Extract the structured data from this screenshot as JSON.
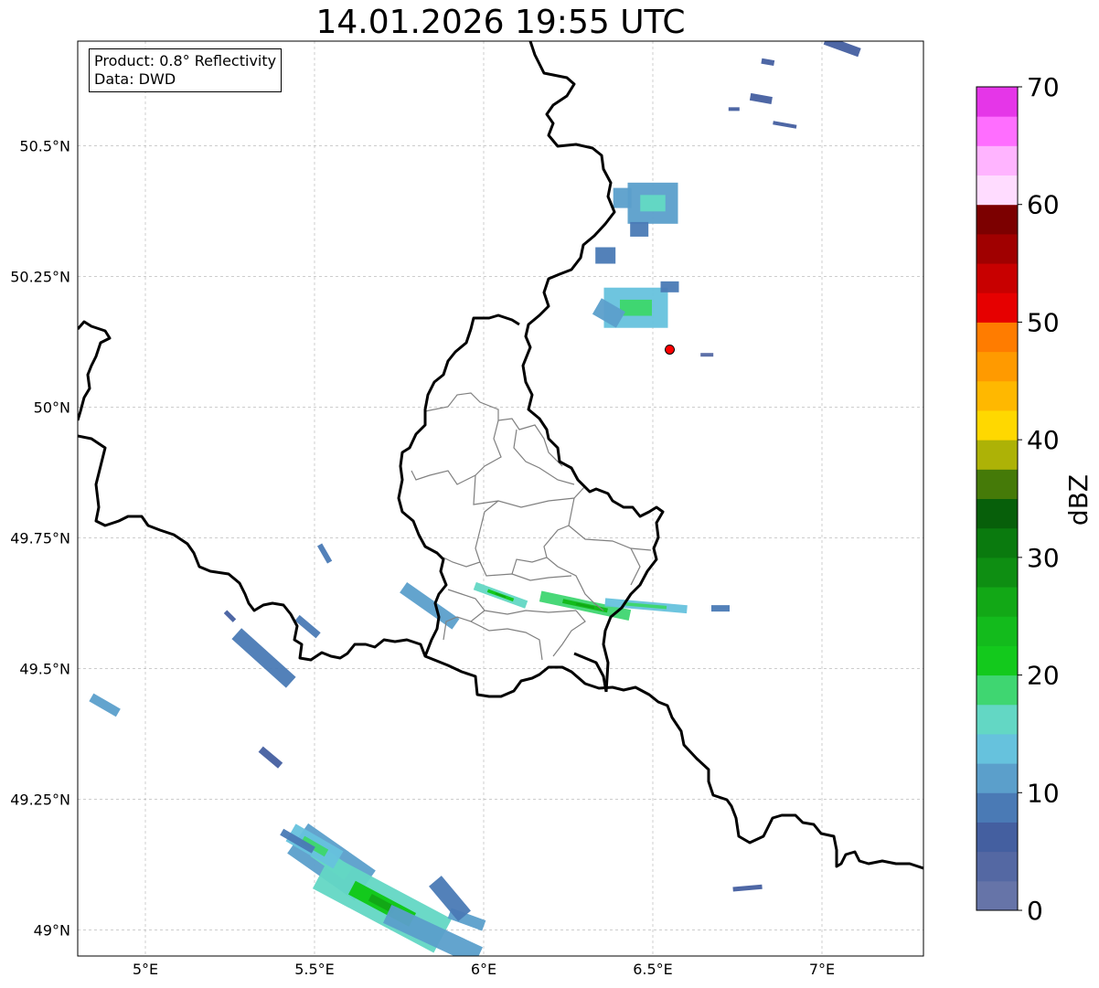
{
  "title": "14.01.2026 19:55 UTC",
  "info_box": {
    "product": "Product: 0.8° Reflectivity",
    "data": "Data: DWD"
  },
  "axes": {
    "lon_range": [
      4.8,
      7.3
    ],
    "lat_range": [
      48.95,
      50.7
    ],
    "lon_ticks": [
      {
        "value": 5.0,
        "label": "5°E"
      },
      {
        "value": 5.5,
        "label": "5.5°E"
      },
      {
        "value": 6.0,
        "label": "6°E"
      },
      {
        "value": 6.5,
        "label": "6.5°E"
      },
      {
        "value": 7.0,
        "label": "7°E"
      }
    ],
    "lat_ticks": [
      {
        "value": 49.0,
        "label": "49°N"
      },
      {
        "value": 49.25,
        "label": "49.25°N"
      },
      {
        "value": 49.5,
        "label": "49.5°N"
      },
      {
        "value": 49.75,
        "label": "49.75°N"
      },
      {
        "value": 50.0,
        "label": "50°N"
      },
      {
        "value": 50.25,
        "label": "50.25°N"
      },
      {
        "value": 50.5,
        "label": "50.5°N"
      }
    ],
    "grid": "dashed"
  },
  "colorbar": {
    "label": "dBZ",
    "min": 0,
    "max": 70,
    "step": 2.5,
    "tick_labels": [
      "0",
      "10",
      "20",
      "30",
      "40",
      "50",
      "60",
      "70"
    ],
    "colors": [
      "#6674a8",
      "#5468a3",
      "#445fa0",
      "#4a7ab5",
      "#5b9fcb",
      "#66c2dd",
      "#63d7c4",
      "#3fd671",
      "#13c91c",
      "#13bb1c",
      "#12a816",
      "#0e8e12",
      "#0a7a0e",
      "#075f0a",
      "#457a08",
      "#adb206",
      "#ffd800",
      "#ffb800",
      "#ff9a00",
      "#ff7c00",
      "#e60000",
      "#c80000",
      "#a00000",
      "#7c0000",
      "#ffdcff",
      "#ffb4ff",
      "#ff6eff",
      "#e536e8"
    ]
  },
  "marker": {
    "lon": 6.55,
    "lat": 50.11,
    "color": "#ff0000"
  },
  "echoes": [
    {
      "lon": 4.88,
      "lat": 49.43,
      "dbz": 10,
      "len": 34,
      "w": 10,
      "ang": 30
    },
    {
      "lon": 5.35,
      "lat": 49.52,
      "dbz": 8,
      "len": 80,
      "w": 16,
      "ang": 42
    },
    {
      "lon": 5.48,
      "lat": 49.58,
      "dbz": 8,
      "len": 30,
      "w": 8,
      "ang": 40
    },
    {
      "lon": 5.37,
      "lat": 49.33,
      "dbz": 6,
      "len": 28,
      "w": 8,
      "ang": 40
    },
    {
      "lon": 5.53,
      "lat": 49.72,
      "dbz": 8,
      "len": 22,
      "w": 6,
      "ang": 60
    },
    {
      "lon": 5.25,
      "lat": 49.6,
      "dbz": 6,
      "len": 14,
      "w": 5,
      "ang": 45
    },
    {
      "lon": 5.84,
      "lat": 49.62,
      "dbz": 10,
      "len": 70,
      "w": 14,
      "ang": 35
    },
    {
      "lon": 6.05,
      "lat": 49.64,
      "dbz": 16,
      "len": 60,
      "w": 9,
      "ang": 20
    },
    {
      "lon": 6.3,
      "lat": 49.62,
      "dbz": 18,
      "len": 100,
      "w": 12,
      "ang": 12
    },
    {
      "lon": 6.48,
      "lat": 49.62,
      "dbz": 14,
      "len": 90,
      "w": 9,
      "ang": 5
    },
    {
      "lon": 6.7,
      "lat": 49.615,
      "dbz": 8,
      "len": 20,
      "w": 7,
      "ang": 0
    },
    {
      "lon": 5.55,
      "lat": 49.13,
      "dbz": 12,
      "len": 90,
      "w": 40,
      "ang": 35
    },
    {
      "lon": 5.7,
      "lat": 49.05,
      "dbz": 16,
      "len": 150,
      "w": 42,
      "ang": 28
    },
    {
      "lon": 5.5,
      "lat": 49.16,
      "dbz": 14,
      "len": 60,
      "w": 22,
      "ang": 30
    },
    {
      "lon": 5.85,
      "lat": 48.99,
      "dbz": 10,
      "len": 110,
      "w": 22,
      "ang": 25
    },
    {
      "lon": 5.95,
      "lat": 49.02,
      "dbz": 10,
      "len": 40,
      "w": 12,
      "ang": 20
    },
    {
      "lon": 5.9,
      "lat": 49.06,
      "dbz": 8,
      "len": 50,
      "w": 18,
      "ang": 50
    },
    {
      "lon": 5.45,
      "lat": 49.17,
      "dbz": 8,
      "len": 40,
      "w": 8,
      "ang": 30
    },
    {
      "lon": 6.41,
      "lat": 50.4,
      "dbz": 10,
      "len": 20,
      "w": 22,
      "ang": 0
    },
    {
      "lon": 6.5,
      "lat": 50.39,
      "dbz": 12,
      "len": 55,
      "w": 45,
      "ang": 0
    },
    {
      "lon": 6.46,
      "lat": 50.34,
      "dbz": 8,
      "len": 20,
      "w": 16,
      "ang": 0
    },
    {
      "lon": 6.36,
      "lat": 50.29,
      "dbz": 8,
      "len": 22,
      "w": 18,
      "ang": 0
    },
    {
      "lon": 6.45,
      "lat": 50.19,
      "dbz": 14,
      "len": 70,
      "w": 44,
      "ang": 0
    },
    {
      "lon": 6.37,
      "lat": 50.18,
      "dbz": 10,
      "len": 30,
      "w": 20,
      "ang": 30
    },
    {
      "lon": 6.55,
      "lat": 50.23,
      "dbz": 8,
      "len": 20,
      "w": 12,
      "ang": 0
    },
    {
      "lon": 6.82,
      "lat": 50.59,
      "dbz": 6,
      "len": 24,
      "w": 8,
      "ang": 10
    },
    {
      "lon": 6.84,
      "lat": 50.66,
      "dbz": 6,
      "len": 14,
      "w": 6,
      "ang": 10
    },
    {
      "lon": 7.06,
      "lat": 50.69,
      "dbz": 6,
      "len": 40,
      "w": 10,
      "ang": 20
    },
    {
      "lon": 6.89,
      "lat": 50.54,
      "dbz": 6,
      "len": 26,
      "w": 4,
      "ang": 10
    },
    {
      "lon": 6.74,
      "lat": 50.57,
      "dbz": 6,
      "len": 12,
      "w": 4,
      "ang": 0
    },
    {
      "lon": 6.78,
      "lat": 49.08,
      "dbz": 6,
      "len": 32,
      "w": 5,
      "ang": -5
    },
    {
      "lon": 6.66,
      "lat": 50.1,
      "dbz": 4,
      "len": 14,
      "w": 4,
      "ang": 0
    }
  ]
}
